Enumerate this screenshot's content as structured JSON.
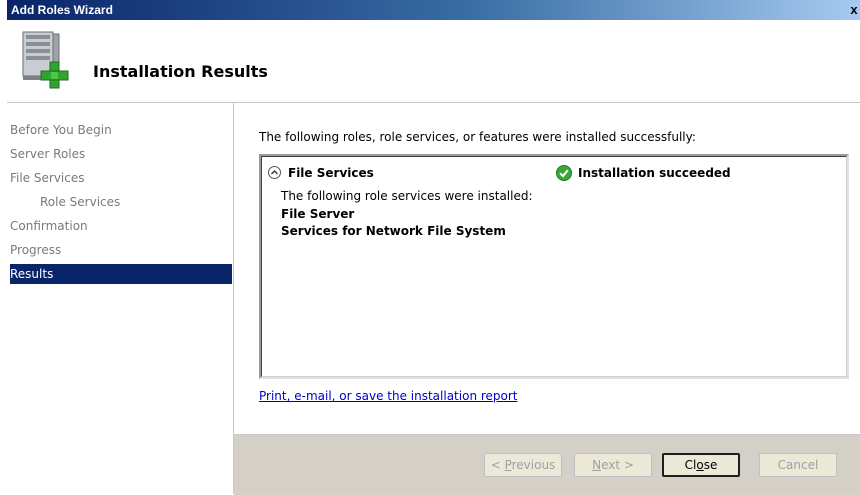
{
  "window": {
    "title": "Add Roles Wizard",
    "close_glyph": "x"
  },
  "header": {
    "title": "Installation Results",
    "icon": "server-add-icon"
  },
  "sidebar": {
    "items": [
      {
        "label": "Before You Begin",
        "active": false,
        "sub": false
      },
      {
        "label": "Server Roles",
        "active": false,
        "sub": false
      },
      {
        "label": "File Services",
        "active": false,
        "sub": false
      },
      {
        "label": "Role Services",
        "active": false,
        "sub": true
      },
      {
        "label": "Confirmation",
        "active": false,
        "sub": false
      },
      {
        "label": "Progress",
        "active": false,
        "sub": false
      },
      {
        "label": "Results",
        "active": true,
        "sub": false
      }
    ]
  },
  "main": {
    "intro": "The following roles, role services, or features were installed successfully:",
    "result": {
      "role": "File Services",
      "status": "Installation succeeded",
      "detail_intro": "The following role services were installed:",
      "services": [
        "File Server",
        "Services for Network File System"
      ]
    },
    "report_link": "Print, e-mail, or save the installation report"
  },
  "footer": {
    "previous_pre": "< ",
    "previous_key": "P",
    "previous_post": "revious",
    "next_pre": "",
    "next_key": "N",
    "next_post": "ext >",
    "close_pre": "Cl",
    "close_key": "o",
    "close_post": "se",
    "cancel": "Cancel"
  },
  "colors": {
    "title_bar": "#0a246a",
    "selected_nav": "#0a246a",
    "link": "#0000cc",
    "success": "#3aa63a"
  }
}
